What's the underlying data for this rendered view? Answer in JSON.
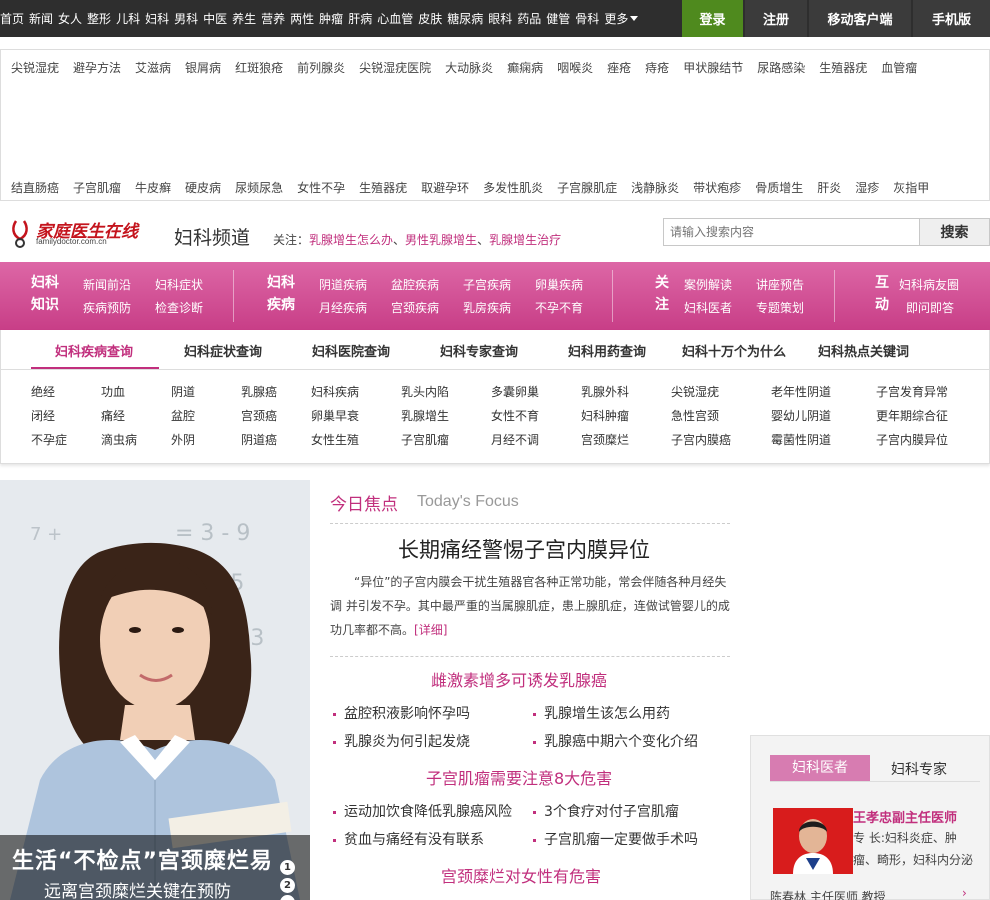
{
  "topnav": [
    "首页",
    "新闻",
    "女人",
    "整形",
    "儿科",
    "妇科",
    "男科",
    "中医",
    "养生",
    "营养",
    "两性",
    "肿瘤",
    "肝病",
    "心血管",
    "皮肤",
    "糖尿病",
    "眼科",
    "药品",
    "健管",
    "骨科"
  ],
  "topnav_more": "更多",
  "top_buttons": {
    "login": "登录",
    "register": "注册",
    "mobile": "移动客户端",
    "phone": "手机版"
  },
  "links_row1": [
    "尖锐湿疣",
    "避孕方法",
    "艾滋病",
    "银屑病",
    "红斑狼疮",
    "前列腺炎",
    "尖锐湿疣医院",
    "大动脉炎",
    "癫痫病",
    "咽喉炎",
    "痤疮",
    "痔疮",
    "甲状腺结节",
    "尿路感染",
    "生殖器疣",
    "血管瘤"
  ],
  "links_row2": [
    "结直肠癌",
    "子宫肌瘤",
    "牛皮癣",
    "硬皮病",
    "尿频尿急",
    "女性不孕",
    "生殖器疣",
    "取避孕环",
    "多发性肌炎",
    "子宫腺肌症",
    "浅静脉炎",
    "带状疱疹",
    "骨质增生",
    "肝炎",
    "湿疹",
    "灰指甲"
  ],
  "logo": {
    "text": "家庭医生在线",
    "sub": "familydoctor.com.cn"
  },
  "channel": "妇科频道",
  "follow": {
    "label": "关注：",
    "links": [
      "乳腺增生怎么办",
      "男性乳腺增生",
      "乳腺增生治疗"
    ],
    "sep": "、"
  },
  "search": {
    "placeholder": "请输入搜索内容",
    "button": "搜索"
  },
  "pinknav": {
    "groups": [
      {
        "cat1": "妇科",
        "cat2": "知识",
        "links": [
          "新闻前沿",
          "妇科症状",
          "疾病预防",
          "检查诊断"
        ]
      },
      {
        "cat1": "妇科",
        "cat2": "疾病",
        "links": [
          "阴道疾病",
          "盆腔疾病",
          "子宫疾病",
          "卵巢疾病",
          "月经疾病",
          "宫颈疾病",
          "乳房疾病",
          "不孕不育"
        ]
      },
      {
        "cat1": "关",
        "cat2": "注",
        "links": [
          "案例解读",
          "讲座预告",
          "妇科医者",
          "专题策划"
        ]
      },
      {
        "cat1": "互",
        "cat2": "动",
        "links": [
          "妇科病友圈",
          "即问即答"
        ]
      }
    ]
  },
  "query_tabs": [
    "妇科疾病查询",
    "妇科症状查询",
    "妇科医院查询",
    "妇科专家查询",
    "妇科用药查询",
    "妇科十万个为什么",
    "妇科热点关键词"
  ],
  "query_rows": [
    [
      "绝经",
      "功血",
      "阴道",
      "乳腺癌",
      "妇科疾病",
      "乳头内陷",
      "多囊卵巢",
      "乳腺外科",
      "尖锐湿疣",
      "老年性阴道",
      "子宫发育异常"
    ],
    [
      "闭经",
      "痛经",
      "盆腔",
      "宫颈癌",
      "卵巢早衰",
      "乳腺增生",
      "女性不育",
      "妇科肿瘤",
      "急性宫颈",
      "婴幼儿阴道",
      "更年期综合征"
    ],
    [
      "不孕症",
      "滴虫病",
      "外阴",
      "阴道癌",
      "女性生殖",
      "子宫肌瘤",
      "月经不调",
      "宫颈糜烂",
      "子宫内膜癌",
      "霉菌性阴道",
      "子宫内膜异位"
    ]
  ],
  "hero": {
    "title": "生活“不检点”宫颈糜烂易",
    "subtitle": "远离宫颈糜烂关键在预防",
    "dots": [
      "1",
      "2"
    ]
  },
  "focus": {
    "label": "今日焦点",
    "label_en": "Today's Focus",
    "title": "长期痛经警惕子宫内膜异位",
    "desc": "“异位”的子宫内膜会干扰生殖器官各种正常功能，常会伴随各种月经失调 并引发不孕。其中最严重的当属腺肌症，患上腺肌症，连做试管婴儿的成功几率都不高。",
    "more": "[详细]"
  },
  "sections": [
    {
      "title": "雌激素增多可诱发乳腺癌",
      "articles": [
        "盆腔积液影响怀孕吗",
        "乳腺增生该怎么用药",
        "乳腺炎为何引起发烧",
        "乳腺癌中期六个变化介绍"
      ]
    },
    {
      "title": "子宫肌瘤需要注意8大危害",
      "articles": [
        "运动加饮食降低乳腺癌风险",
        "3个食疗对付子宫肌瘤",
        "贫血与痛经有没有联系",
        "子宫肌瘤一定要做手术吗"
      ]
    },
    {
      "title": "宫颈糜烂对女性有危害",
      "articles": []
    }
  ],
  "expert": {
    "tab_active": "妇科医者",
    "tab_other": "妇科专家",
    "name": "王孝忠副主任医师",
    "lines": [
      "专  长:妇科炎症、肿",
      "瘤、畸形，妇科内分泌"
    ],
    "next": "陈春林  主任医师  教授",
    "arrow": "›"
  },
  "colors": {
    "accent": "#c12f7d",
    "login_green": "#4f8a1e",
    "topbar": "#2e2e2e"
  }
}
